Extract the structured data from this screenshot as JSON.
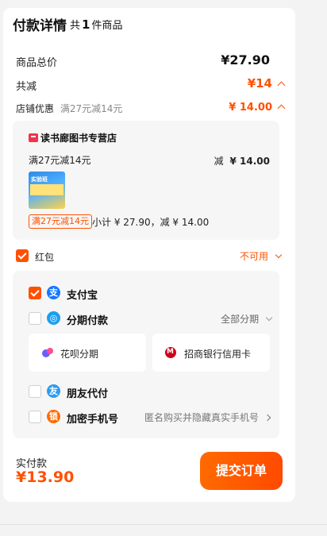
{
  "header": {
    "title": "付款详情",
    "count_prefix": "共",
    "count": "1",
    "count_suffix": "件商品"
  },
  "summary": {
    "total_label": "商品总价",
    "total_value": "¥27.90",
    "discount_label": "共减",
    "discount_value": "¥14",
    "shop_discount_label": "店铺优惠",
    "shop_discount_rule": "满27元减14元",
    "shop_discount_value": "¥ 14.00"
  },
  "shop": {
    "name": "读书廊图书专营店",
    "rule": "满27元减14元",
    "reduce_label": "减",
    "reduce_value": "¥ 14.00",
    "thumb_text": "实验班",
    "tag": "满27元减14元",
    "subtotal": "小计 ¥ 27.90，减 ¥ 14.00"
  },
  "redpacket": {
    "label": "红包",
    "status": "不可用"
  },
  "payment": {
    "alipay": "支付宝",
    "installment": "分期付款",
    "installment_right": "全部分期",
    "huabei": "花呗分期",
    "cmb": "招商银行信用卡",
    "friend": "朋友代付",
    "encrypt": "加密手机号",
    "encrypt_hint": "匿名购买并隐藏真实手机号"
  },
  "footer": {
    "paid_label": "实付款",
    "paid_value": "¥13.90",
    "submit": "提交订单"
  },
  "colors": {
    "accent": "#ff5000",
    "panel": "#f6f6f6",
    "alipay": "#1677ff",
    "installment": "#1aa0f0",
    "friend": "#2d9cf0",
    "encrypt": "#ff6a00"
  }
}
